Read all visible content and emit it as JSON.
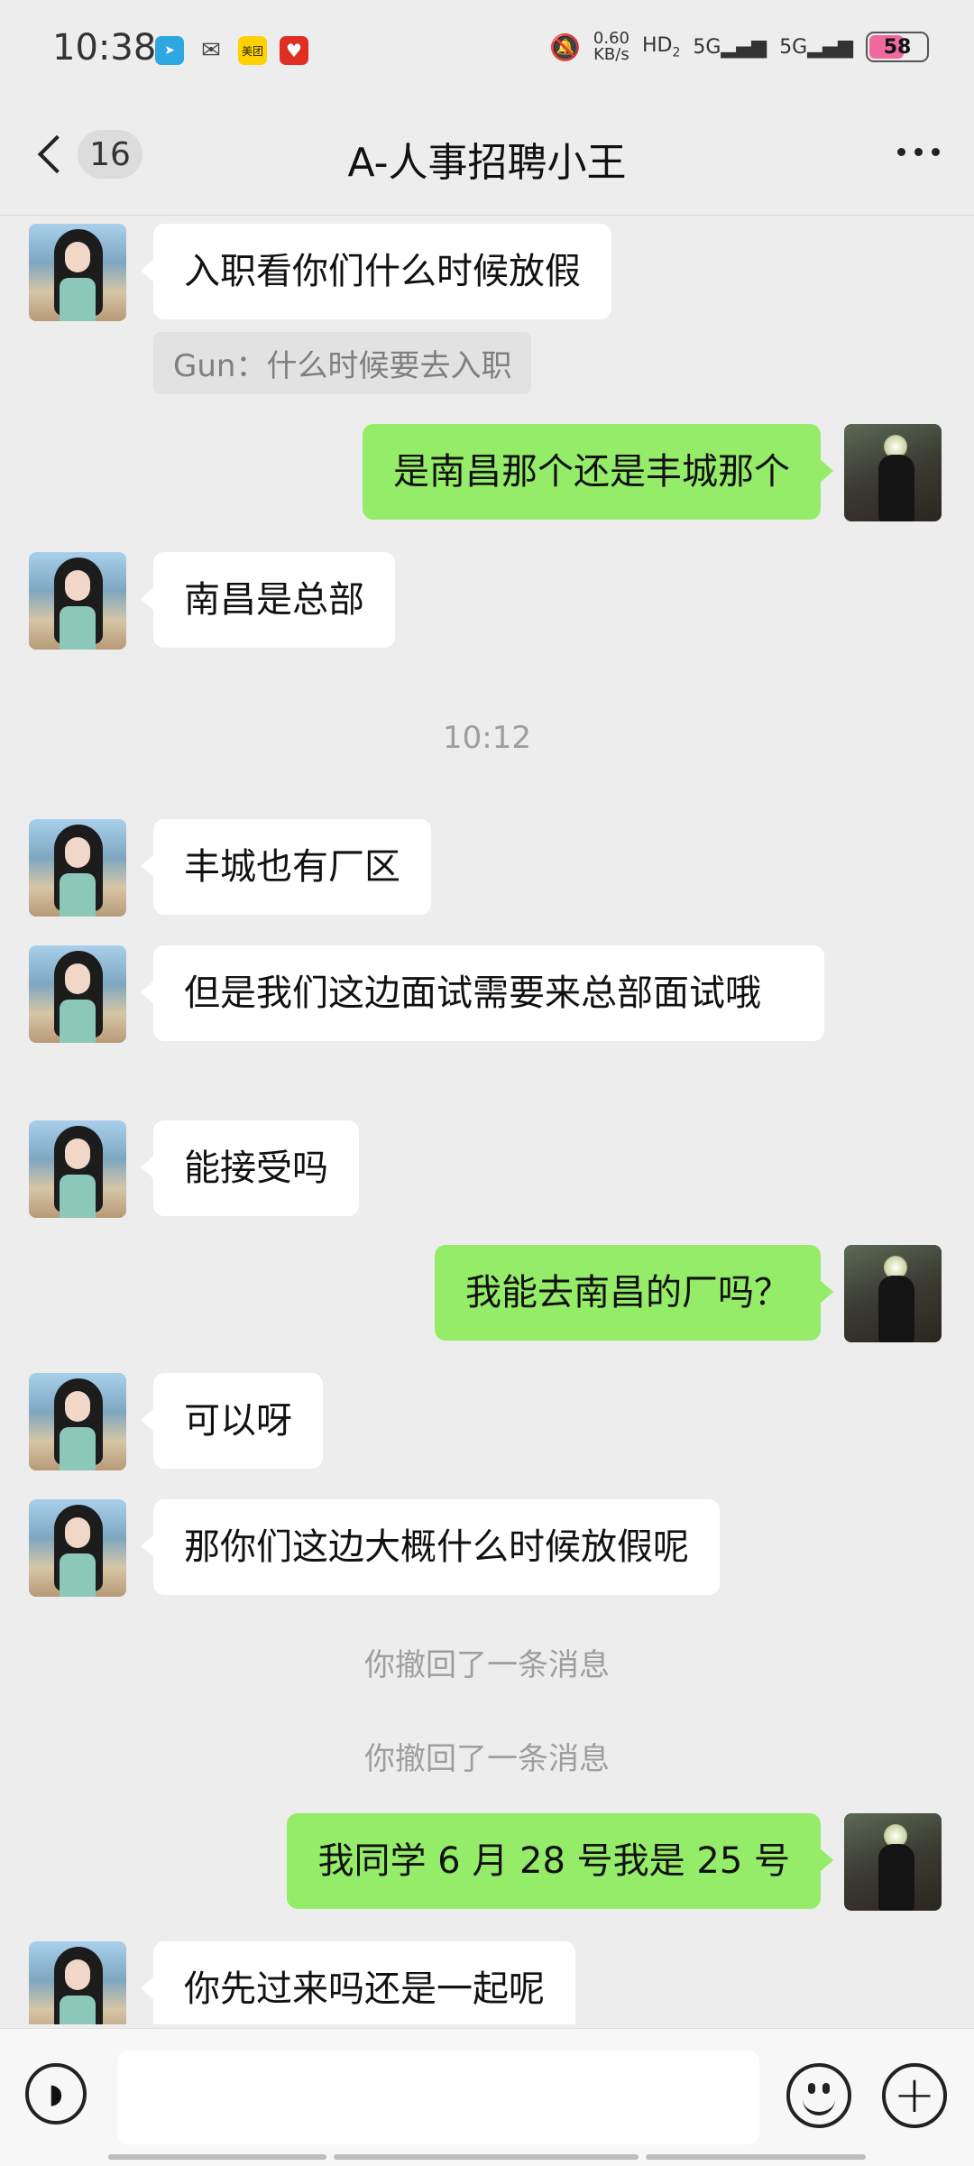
{
  "status_bar": {
    "time": "10:38",
    "speed_value": "0.60",
    "speed_unit": "KB/s",
    "hd": "HD",
    "hd_sub": "2",
    "signal1": "5G",
    "signal2": "5G",
    "battery": "58",
    "battery_level": 0.58,
    "app_icons": [
      "telegram-icon",
      "wechat-icon",
      "meituan-icon",
      "pinduoduo-icon"
    ],
    "meituan_label": "美团"
  },
  "header": {
    "unread_count": "16",
    "title": "A-人事招聘小王"
  },
  "messages": {
    "m1": "入职看你们什么时候放假",
    "quote1": "Gun：什么时候要去入职",
    "m2": "是南昌那个还是丰城那个",
    "m3": "南昌是总部",
    "time1": "10:12",
    "m4": "丰城也有厂区",
    "m5": "但是我们这边面试需要来总部面试哦",
    "m6": "能接受吗",
    "m7": "我能去南昌的厂吗？",
    "m8": "可以呀",
    "m9": "那你们这边大概什么时候放假呢",
    "recall1": "你撤回了一条消息",
    "recall2": "你撤回了一条消息",
    "m10": "我同学 6 月 28 号我是 25 号",
    "m11": "你先过来吗还是一起呢"
  },
  "input_bar": {
    "placeholder": ""
  },
  "colors": {
    "background": "#ededed",
    "bubble_out": "#95ec69",
    "bubble_in": "#ffffff",
    "battery": "#f06a9f"
  }
}
